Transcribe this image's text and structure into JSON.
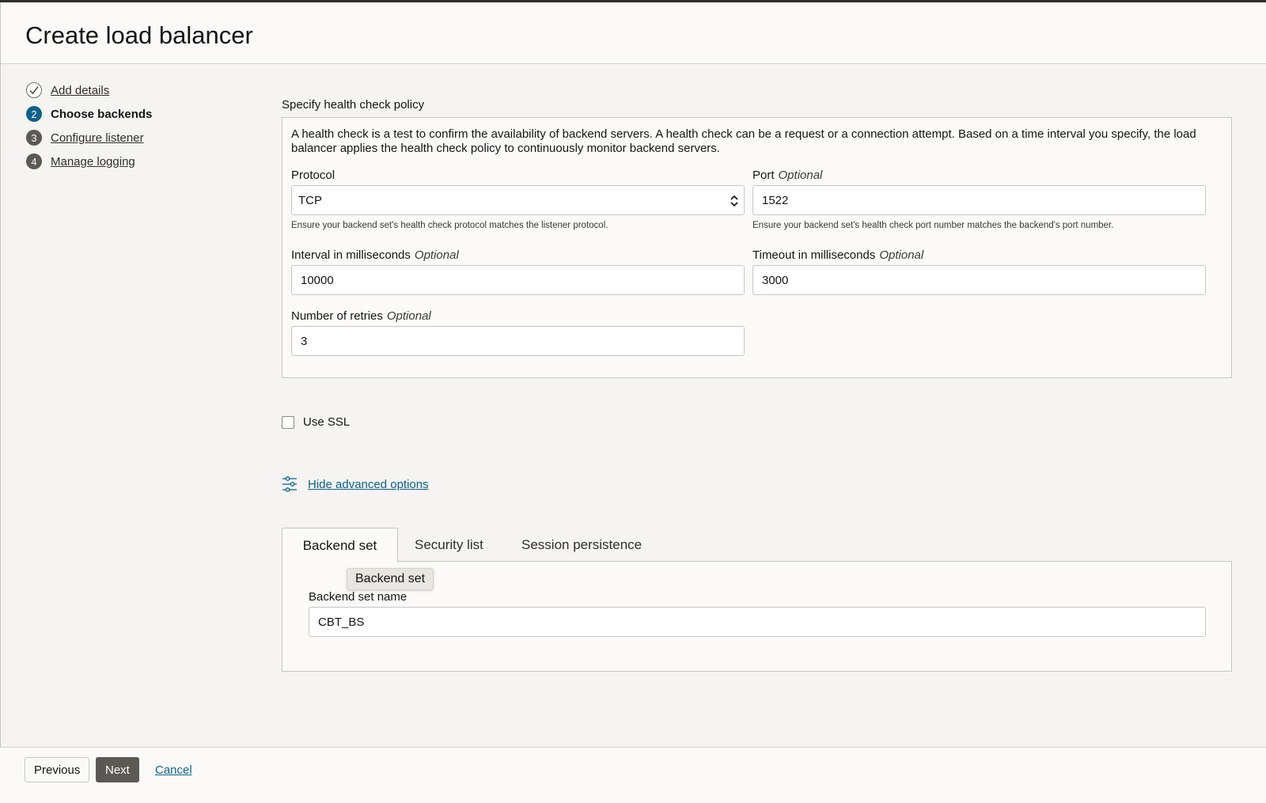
{
  "header": {
    "title": "Create load balancer"
  },
  "steps": [
    {
      "number": "",
      "label": "Add details",
      "state": "done"
    },
    {
      "number": "2",
      "label": "Choose backends",
      "state": "current"
    },
    {
      "number": "3",
      "label": "Configure listener",
      "state": "todo"
    },
    {
      "number": "4",
      "label": "Manage logging",
      "state": "todo"
    }
  ],
  "health_check": {
    "section_title": "Specify health check policy",
    "description": "A health check is a test to confirm the availability of backend servers. A health check can be a request or a connection attempt. Based on a time interval you specify, the load balancer applies the health check policy to continuously monitor backend servers.",
    "protocol": {
      "label": "Protocol",
      "value": "TCP",
      "help": "Ensure your backend set's health check protocol matches the listener protocol."
    },
    "port": {
      "label": "Port",
      "optional": "Optional",
      "value": "1522",
      "help": "Ensure your backend set's health check port number matches the backend's port number."
    },
    "interval": {
      "label": "Interval in milliseconds",
      "optional": "Optional",
      "value": "10000"
    },
    "timeout": {
      "label": "Timeout in milliseconds",
      "optional": "Optional",
      "value": "3000"
    },
    "retries": {
      "label": "Number of retries",
      "optional": "Optional",
      "value": "3"
    }
  },
  "ssl": {
    "label": "Use SSL",
    "checked": false
  },
  "advanced": {
    "link_label": "Hide advanced options"
  },
  "tabs": [
    {
      "label": "Backend set",
      "active": true
    },
    {
      "label": "Security list",
      "active": false
    },
    {
      "label": "Session persistence",
      "active": false
    }
  ],
  "tooltip": {
    "text": "Backend set"
  },
  "backend_set": {
    "name_label": "Backend set name",
    "name_value": "CBT_BS"
  },
  "footer": {
    "previous_label": "Previous",
    "next_label": "Next",
    "cancel_label": "Cancel"
  },
  "colors": {
    "accent": "#0e6189",
    "primary_button": "#5c5854",
    "background": "#f5f4f2",
    "panel": "#fbfaf8",
    "border": "#c9c6c1"
  }
}
